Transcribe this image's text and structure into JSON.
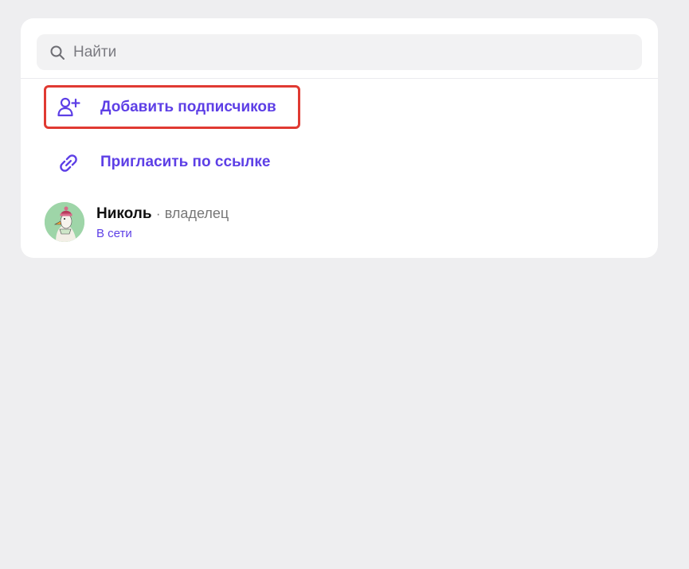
{
  "search": {
    "placeholder": "Найти",
    "value": "",
    "icon": "search-icon"
  },
  "actions": {
    "add_subscribers": {
      "label": "Добавить подписчиков",
      "icon": "add-user-icon"
    },
    "invite_link": {
      "label": "Пригласить по ссылке",
      "icon": "link-icon"
    }
  },
  "members": [
    {
      "name": "Николь",
      "separator": "·",
      "role": "владелец",
      "status": "В сети"
    }
  ],
  "colors": {
    "accent": "#5D3FE6",
    "highlight_border": "#E03A32",
    "background": "#EEEEF0",
    "card": "#FFFFFF",
    "search_bg": "#F2F2F3"
  }
}
